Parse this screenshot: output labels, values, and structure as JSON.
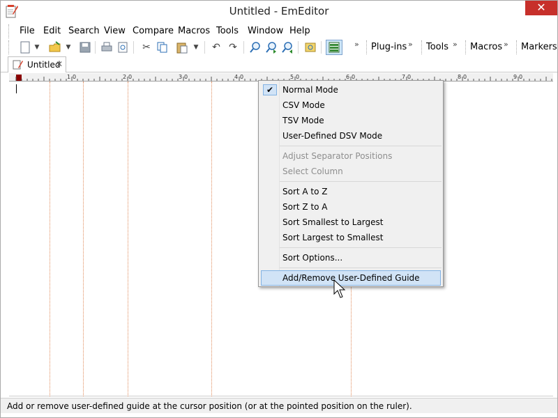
{
  "window": {
    "title": "Untitled - EmEditor",
    "close_glyph": "✕",
    "app_icon": "notepad-pencil-icon"
  },
  "menubar": {
    "items": [
      "File",
      "Edit",
      "Search",
      "View",
      "Compare",
      "Macros",
      "Tools",
      "Window",
      "Help"
    ]
  },
  "toolbar": {
    "icons": [
      "new-file-icon",
      "dropdown-arrow-icon",
      "open-folder-icon",
      "dropdown-arrow-icon",
      "save-icon",
      "print-icon",
      "print-preview-icon",
      "cut-icon",
      "copy-icon",
      "paste-icon",
      "dropdown-arrow-icon",
      "undo-icon",
      "redo-icon",
      "find-icon",
      "find-next-icon",
      "find-previous-icon",
      "highlight-icon",
      "csv-mode-icon"
    ],
    "groups": [
      "Plug-ins",
      "Tools",
      "Macros",
      "Markers"
    ],
    "chevron": "»"
  },
  "tab": {
    "label": "Untitled",
    "close_glyph": "✕"
  },
  "ruler": {
    "labels": [
      "1",
      "0",
      "2",
      "0",
      "3",
      "0",
      "4",
      "0",
      "5",
      "0",
      "6",
      "0",
      "7",
      "0",
      "8",
      "0",
      "9",
      "0"
    ]
  },
  "context_menu": {
    "items": [
      {
        "label": "Normal Mode",
        "checked": true,
        "disabled": false
      },
      {
        "label": "CSV Mode",
        "checked": false,
        "disabled": false
      },
      {
        "label": "TSV Mode",
        "checked": false,
        "disabled": false
      },
      {
        "label": "User-Defined DSV Mode",
        "checked": false,
        "disabled": false
      },
      {
        "label": "Adjust Separator Positions",
        "checked": false,
        "disabled": true
      },
      {
        "label": "Select Column",
        "checked": false,
        "disabled": true
      },
      {
        "label": "Sort A to Z",
        "checked": false,
        "disabled": false
      },
      {
        "label": "Sort Z to A",
        "checked": false,
        "disabled": false
      },
      {
        "label": "Sort Smallest to Largest",
        "checked": false,
        "disabled": false
      },
      {
        "label": "Sort Largest to Smallest",
        "checked": false,
        "disabled": false
      },
      {
        "label": "Sort Options...",
        "checked": false,
        "disabled": false
      },
      {
        "label": "Add/Remove User-Defined Guide",
        "checked": false,
        "disabled": false,
        "hovered": true
      }
    ],
    "check_glyph": "✔"
  },
  "statusbar": {
    "text": "Add or remove user-defined guide at the cursor position (or at the pointed position on the ruler)."
  },
  "colors": {
    "close_button": "#c7302b",
    "menu_highlight": "#d1e3f6",
    "menu_highlight_border": "#82b2e3",
    "guide_line": "#e08a5a",
    "ruler_mark": "#8b0000"
  }
}
